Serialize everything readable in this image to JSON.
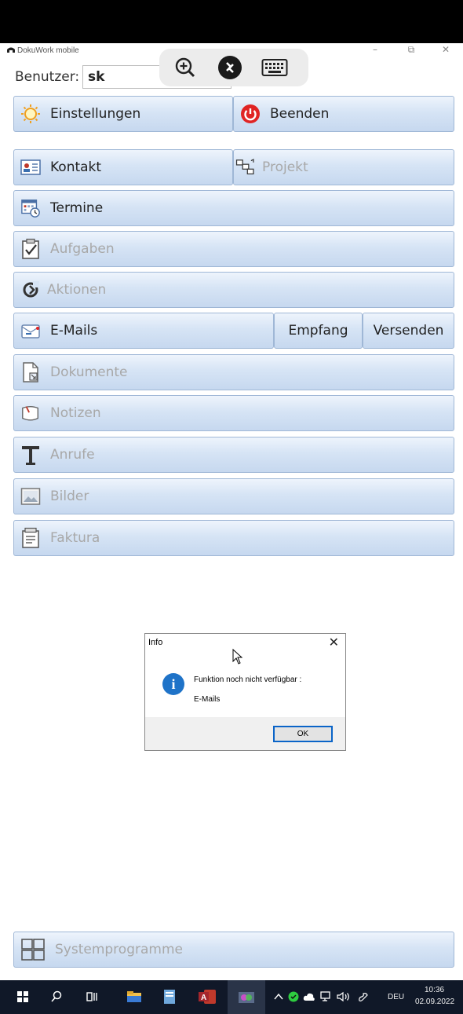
{
  "app": {
    "title": "DokuWork mobile",
    "window_controls": {
      "minimize": "–",
      "restore": "⧉",
      "close": "✕"
    }
  },
  "user": {
    "label": "Benutzer:",
    "value": "sk"
  },
  "remote_toolbar": {
    "icons": [
      "zoom-in-icon",
      "remote-connect-icon",
      "keyboard-icon"
    ]
  },
  "buttons": {
    "settings": "Einstellungen",
    "quit": "Beenden",
    "contact": "Kontakt",
    "project": "Projekt",
    "appointments": "Termine",
    "tasks": "Aufgaben",
    "actions": "Aktionen",
    "emails": "E-Mails",
    "receive": "Empfang",
    "send": "Versenden",
    "documents": "Dokumente",
    "notes": "Notizen",
    "calls": "Anrufe",
    "images": "Bilder",
    "invoicing": "Faktura",
    "system_programs": "Systemprogramme"
  },
  "dialog": {
    "title": "Info",
    "message": "Funktion noch nicht verfügbar :",
    "value": "E-Mails",
    "ok": "OK",
    "close": "✕"
  },
  "taskbar": {
    "language": "DEU",
    "time": "10:36",
    "date": "02.09.2022"
  },
  "colors": {
    "button_top": "#eef4fc",
    "button_bottom": "#c6d8ef",
    "button_border": "#9fb7d6",
    "disabled_text": "#a8a8a8",
    "quit_red": "#e02424",
    "info_blue": "#1f73c8",
    "taskbar": "#101828"
  }
}
